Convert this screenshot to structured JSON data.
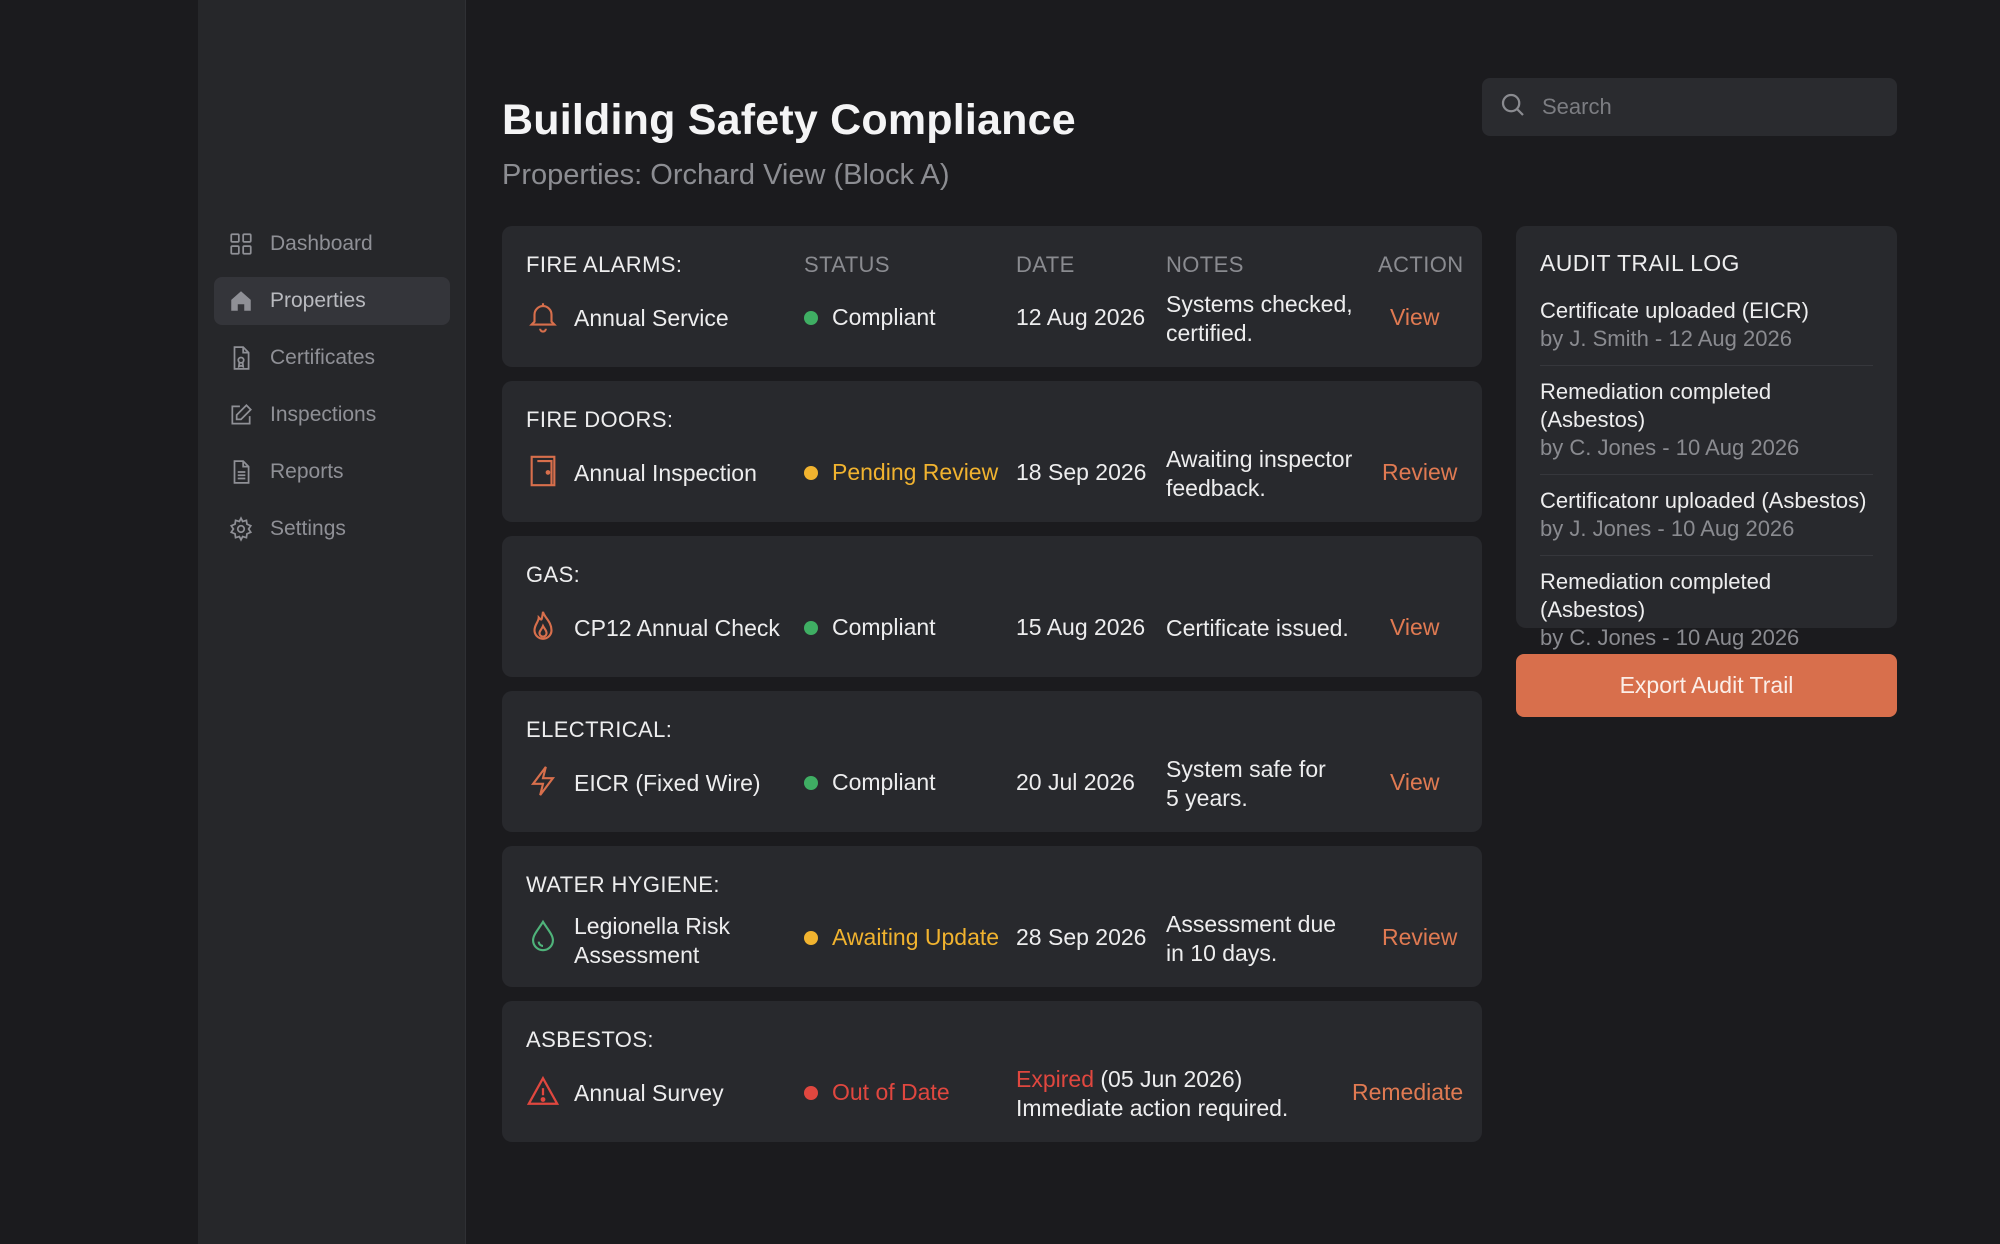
{
  "colors": {
    "accent": "#d86f4c",
    "compliant": "#3fae63",
    "pending": "#f1b32f",
    "danger": "#e0473f"
  },
  "sidebar": {
    "items": [
      {
        "label": "Dashboard",
        "icon": "grid-icon",
        "active": false
      },
      {
        "label": "Properties",
        "icon": "home-icon",
        "active": true
      },
      {
        "label": "Certificates",
        "icon": "certificate-icon",
        "active": false
      },
      {
        "label": "Inspections",
        "icon": "edit-icon",
        "active": false
      },
      {
        "label": "Reports",
        "icon": "document-icon",
        "active": false
      },
      {
        "label": "Settings",
        "icon": "gear-icon",
        "active": false
      }
    ]
  },
  "header": {
    "title": "Building Safety Compliance",
    "subtitle": "Properties: Orchard View (Block A)"
  },
  "search": {
    "placeholder": "Search",
    "value": ""
  },
  "columns": {
    "status": "STATUS",
    "date": "DATE",
    "notes": "NOTES",
    "action": "ACTION"
  },
  "rows": [
    {
      "category": "FIRE ALARMS:",
      "icon": "bell-icon",
      "item": "Annual Service",
      "status": "Compliant",
      "status_type": "compliant",
      "date": "12 Aug 2026",
      "notes": "Systems checked, certified.",
      "action": "View"
    },
    {
      "category": "FIRE DOORS:",
      "icon": "door-icon",
      "item": "Annual Inspection",
      "status": "Pending Review",
      "status_type": "pending",
      "date": "18 Sep 2026",
      "notes": "Awaiting inspector feedback.",
      "action": "Review"
    },
    {
      "category": "GAS:",
      "icon": "flame-icon",
      "item": "CP12 Annual Check",
      "status": "Compliant",
      "status_type": "compliant",
      "date": "15 Aug 2026",
      "notes": "Certificate issued.",
      "action": "View"
    },
    {
      "category": "ELECTRICAL:",
      "icon": "lightning-icon",
      "item": "EICR (Fixed Wire)",
      "status": "Compliant",
      "status_type": "compliant",
      "date": "20 Jul 2026",
      "notes": "System safe for 5 years.",
      "action": "View"
    },
    {
      "category": "WATER HYGIENE:",
      "icon": "water-drop-icon",
      "item": "Legionella Risk Assessment",
      "status": "Awaiting Update",
      "status_type": "pending",
      "date": "28 Sep 2026",
      "notes": "Assessment due in 10 days.",
      "action": "Review"
    },
    {
      "category": "ASBESTOS:",
      "icon": "warning-icon",
      "item": "Annual Survey",
      "status": "Out of Date",
      "status_type": "danger",
      "notes_expired": "Expired",
      "notes_expired_date": "(05 Jun 2026)",
      "notes_line2": "Immediate action required.",
      "action": "Remediate"
    }
  ],
  "audit": {
    "title": "AUDIT TRAIL LOG",
    "entries": [
      {
        "event": "Certificate uploaded (EICR)",
        "meta": "by J. Smith - 12 Aug 2026"
      },
      {
        "event": "Remediation completed (Asbestos)",
        "meta": "by C. Jones - 10 Aug 2026"
      },
      {
        "event": "Certificatonr uploaded (Asbestos)",
        "meta": "by J. Jones - 10 Aug 2026"
      },
      {
        "event": "Remediation completed (Asbestos)",
        "meta": "by C. Jones - 10 Aug 2026"
      }
    ],
    "export_label": "Export Audit Trail"
  }
}
